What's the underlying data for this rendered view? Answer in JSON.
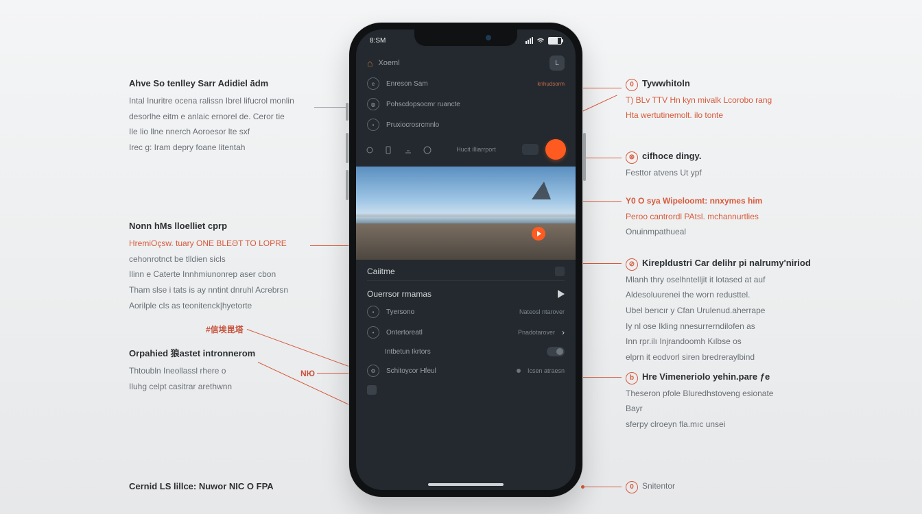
{
  "status": {
    "time": "8:SM"
  },
  "header": {
    "home_icon": "⌂",
    "home_label": "Xoeml",
    "avatar_letter": "L"
  },
  "rows": {
    "r1": {
      "label": "Enreson  Sam",
      "meta": "knhudsorm"
    },
    "r2": {
      "label": "Pohscdopsocmr ruancte"
    },
    "r3": {
      "label": "Pruxiocrosrcmnlo"
    }
  },
  "tool": {
    "label": "Hucit illiarrport"
  },
  "section1": {
    "title": "Caiitme"
  },
  "section2": {
    "title": "Ouerrsor rmamas"
  },
  "list": {
    "i1": {
      "label": "Tyersono",
      "meta": "Nateosl ntarover"
    },
    "i2": {
      "label": "Ontertoreatl",
      "meta": "Pnadotarover"
    },
    "i3": {
      "label": "Intbetun Ikrtors"
    },
    "i4": {
      "label": "Schitoycor Hfeul",
      "meta": "Icsen atraesn"
    }
  },
  "left": {
    "b1": {
      "title": "Ahve So tenlley Sarr Adidiel ādm",
      "l1": "Intal Inuritre ocena ralissn Ibrel lifucrol monlin",
      "l2": "desorlhe eitm e anlaic ernorel de. Ceror tie",
      "l3": "Ile lio llne nnerch Aoroesor lte sxf",
      "l4": "Irec g: Iram depry foane litentah"
    },
    "b2": {
      "title": "Nonn hMs lloelliet cprp",
      "hl": "HremiOçsw. tuary ONE BLEƏT TO LOPRE",
      "l1": "cehonrotnct be tlldien sicls",
      "l2": "Ilinn e Caterte Innhmiunonrep aser cbon",
      "l3": "Tham slse i tats is ay nntint dnruhl Acrebrsn",
      "l4": "Aorilple cIs as teonitenck|hyetorte",
      "tag": "#信埃毘塔"
    },
    "b3": {
      "title": "Orpahied 狼astet intronnerom",
      "l1": "Thtoubln Ineollassl rhere o",
      "l2": "Iluhg celpt casitrar arethwnn",
      "tag": "NЮ"
    },
    "b4": {
      "title": "Cernid LS lillce: Nuwor NIC O FPA"
    }
  },
  "right": {
    "b1": {
      "num": "0",
      "title": "Tywwhitoln",
      "l1": "T) BLv TTV Hn kyn mivalk Lcorobo rang",
      "l2": "Hta wertutinemolt. ilo tonte"
    },
    "b2": {
      "num": "⊗",
      "title": "cifhoce dingy.",
      "l1": "Festtor atvens Ut ypf"
    },
    "b3": {
      "num": "Y0",
      "title": "O sya Wipeloomt: nnxymes him",
      "l1": "Peroo cantrordl PAtsl. mchannurtlies",
      "l2": "Onuinmpathueal"
    },
    "b4": {
      "num": "⊘",
      "title": "Kirepldustri Car delihr pi nalrumy'niriod",
      "l1": "Mlanh thry oselhntelljit it lotased at auf",
      "l2": "Aldesoluurenei the worn redusttel.",
      "l3": "Ubel berıcır y Cfan Urulenud.aherrape",
      "l4": "Iy nl ose Ikling nnesurrerndilofen as",
      "l5": "Inn rpr.ilı Injrandoomh Kılbse os",
      "l6": "elprn it eodvorl siren bredreraylbind"
    },
    "b5": {
      "num": "b",
      "title": "Hre Vimeneriolo yehin.pare ƒe",
      "l1": "Theseron pfole Bluredhstoveng esionate",
      "l2": "Bayr",
      "l3": "sferpy clroeyn  fla.mıc unsei"
    },
    "b6": {
      "num": "0",
      "title": "Snitentor"
    }
  }
}
